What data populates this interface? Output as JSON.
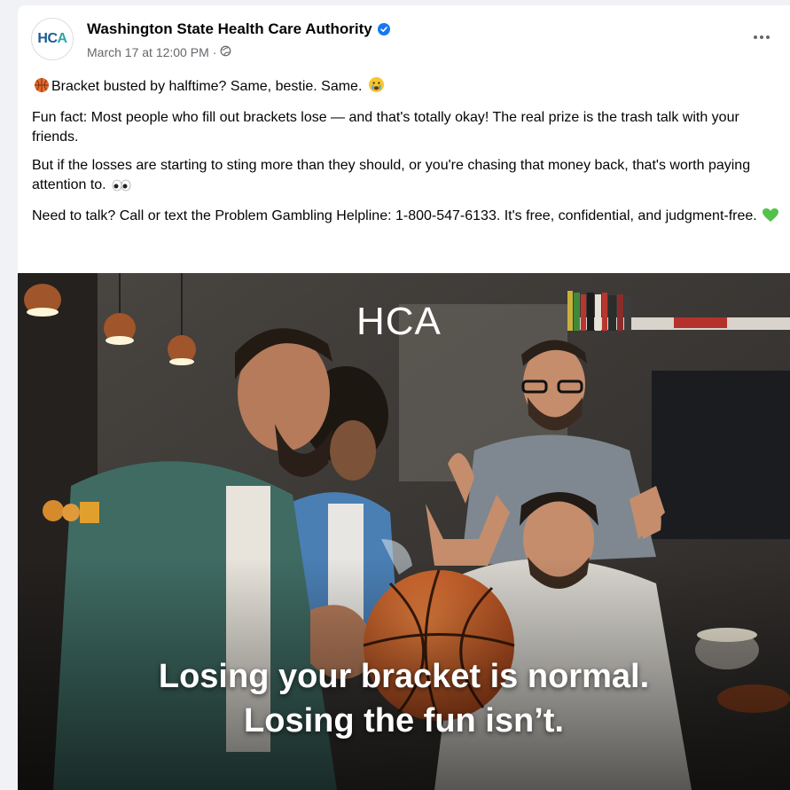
{
  "post": {
    "page_name": "Washington State Health Care Authority",
    "timestamp": "March 17 at 12:00 PM",
    "audience_separator": "·",
    "avatar_text_main": "HC",
    "avatar_text_accent": "A",
    "paragraphs": [
      "Bracket busted by halftime? Same, bestie. Same.",
      "Fun fact: Most people who fill out brackets lose — and that's totally okay! The real prize is the trash talk with your friends.",
      "But if the losses are starting to sting more than they should, or you're chasing that money back, that's worth paying attention to.",
      "Need to talk? Call or text the Problem Gambling Helpline: 1-800-547-6133. It's free, confidential, and judgment-free."
    ],
    "icons": {
      "verified": "verified-badge-icon",
      "audience": "globe-icon",
      "more": "more-options-icon",
      "p1_start": "basketball-emoji",
      "p1_end": "crying-face-emoji",
      "p3_end": "eyes-emoji",
      "p4_end": "green-heart-emoji"
    }
  },
  "image": {
    "logo_text": "HCA",
    "caption_line1": "Losing your bracket is normal.",
    "caption_line2": "Losing the fun isn’t."
  },
  "colors": {
    "brand_blue": "#1877f2",
    "hca_navy": "#1c5a96",
    "hca_teal": "#27a9a6",
    "text_primary": "#050505",
    "text_secondary": "#65676b"
  }
}
